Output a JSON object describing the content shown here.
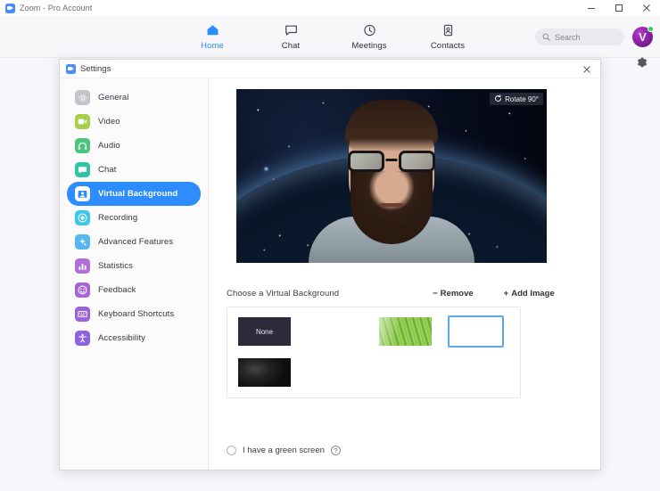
{
  "os_window": {
    "title": "Zoom - Pro Account",
    "controls": [
      {
        "name": "minimize",
        "glyph": "minimize-icon"
      },
      {
        "name": "maximize",
        "glyph": "maximize-icon"
      },
      {
        "name": "close",
        "glyph": "close-icon"
      }
    ]
  },
  "navbar": {
    "tabs": [
      {
        "label": "Home",
        "icon": "home-icon",
        "active": true
      },
      {
        "label": "Chat",
        "icon": "chat-bubble-icon",
        "active": false
      },
      {
        "label": "Meetings",
        "icon": "clock-icon",
        "active": false
      },
      {
        "label": "Contacts",
        "icon": "contact-card-icon",
        "active": false
      }
    ],
    "search": {
      "placeholder": "Search",
      "icon": "search-icon"
    },
    "avatar": {
      "glyph": "V",
      "status": "online",
      "status_color": "#2fd44e"
    },
    "settings_gear": "gear-icon",
    "active_color": "#2d8cff"
  },
  "settings_dialog": {
    "title": "Settings",
    "close_icon": "close-icon",
    "sidebar": {
      "items": [
        {
          "label": "General",
          "icon": "gear-icon",
          "color": "#c3c3cb",
          "active": false
        },
        {
          "label": "Video",
          "icon": "camera-icon",
          "color": "#a8cf4a",
          "active": false
        },
        {
          "label": "Audio",
          "icon": "headphones-icon",
          "color": "#4bc47d",
          "active": false
        },
        {
          "label": "Chat",
          "icon": "chat-bubble-icon",
          "color": "#2fc4a5",
          "active": false
        },
        {
          "label": "Virtual Background",
          "icon": "person-card-icon",
          "color": "#2d8cff",
          "active": true
        },
        {
          "label": "Recording",
          "icon": "record-icon",
          "color": "#3ec8e8",
          "active": false
        },
        {
          "label": "Advanced Features",
          "icon": "sparkle-icon",
          "color": "#56b7f0",
          "active": false
        },
        {
          "label": "Statistics",
          "icon": "bar-chart-icon",
          "color": "#b06fd6",
          "active": false
        },
        {
          "label": "Feedback",
          "icon": "smiley-icon",
          "color": "#a863d9",
          "active": false
        },
        {
          "label": "Keyboard Shortcuts",
          "icon": "keyboard-icon",
          "color": "#9a63dd",
          "active": false
        },
        {
          "label": "Accessibility",
          "icon": "accessibility-icon",
          "color": "#8e63e0",
          "active": false
        }
      ]
    },
    "content": {
      "video_preview": {
        "rotate_button": {
          "label": "Rotate 90°",
          "icon": "rotate-icon"
        },
        "scene": "person with glasses and beard in front of earth-from-space virtual background"
      },
      "choose_title": "Choose a Virtual Background",
      "remove_button": {
        "label": "Remove",
        "prefix": "−"
      },
      "add_image_button": {
        "label": "Add Image",
        "prefix": "+"
      },
      "thumbnails": [
        {
          "name": "none",
          "label": "None",
          "selected": false
        },
        {
          "name": "bridge",
          "label": "",
          "selected": false
        },
        {
          "name": "grass",
          "label": "",
          "selected": false
        },
        {
          "name": "space",
          "label": "",
          "selected": true
        },
        {
          "name": "dark",
          "label": "",
          "selected": false
        }
      ],
      "green_screen": {
        "label": "I have a green screen",
        "checked": false,
        "help_glyph": "?"
      }
    }
  }
}
